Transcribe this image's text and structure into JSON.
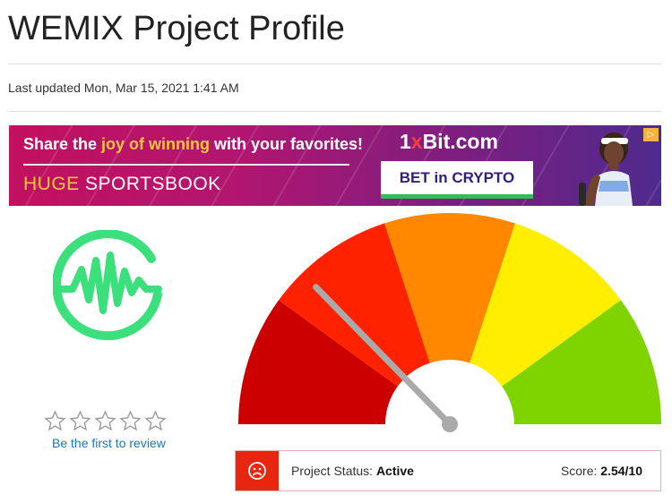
{
  "page": {
    "title": "WEMIX Project Profile",
    "last_updated": "Last updated Mon, Mar 15, 2021 1:41 AM"
  },
  "banner": {
    "line1_prefix": "Share the ",
    "line1_highlight": "joy of winning",
    "line1_suffix": " with your favorites!",
    "line2_highlight": "HUGE",
    "line2_rest": " SPORTSBOOK",
    "brand_prefix": "1",
    "brand_x": "x",
    "brand_rest": "Bit.com",
    "cta_label": "BET in CRYPTO",
    "colors": {
      "highlight": "#f2c73b",
      "cta_text": "#33207d",
      "cta_border": "#2fbf54"
    }
  },
  "rating": {
    "stars_filled": 0,
    "stars_total": 5,
    "review_link": "Be the first to review"
  },
  "gauge": {
    "score": 2.54,
    "max": 10,
    "segments": [
      "#cc0000",
      "#ff2200",
      "#ff8800",
      "#ffee00",
      "#7fd400"
    ],
    "needle_color": "#aaaaaa"
  },
  "status": {
    "label": "Project Status: ",
    "value": "Active",
    "score_label": "Score: ",
    "score_value": "2.54/10",
    "icon": "sad-face-icon",
    "icon_bg": "#e8260f"
  },
  "colors": {
    "logo": "#3be07c",
    "link": "#1e73be"
  }
}
